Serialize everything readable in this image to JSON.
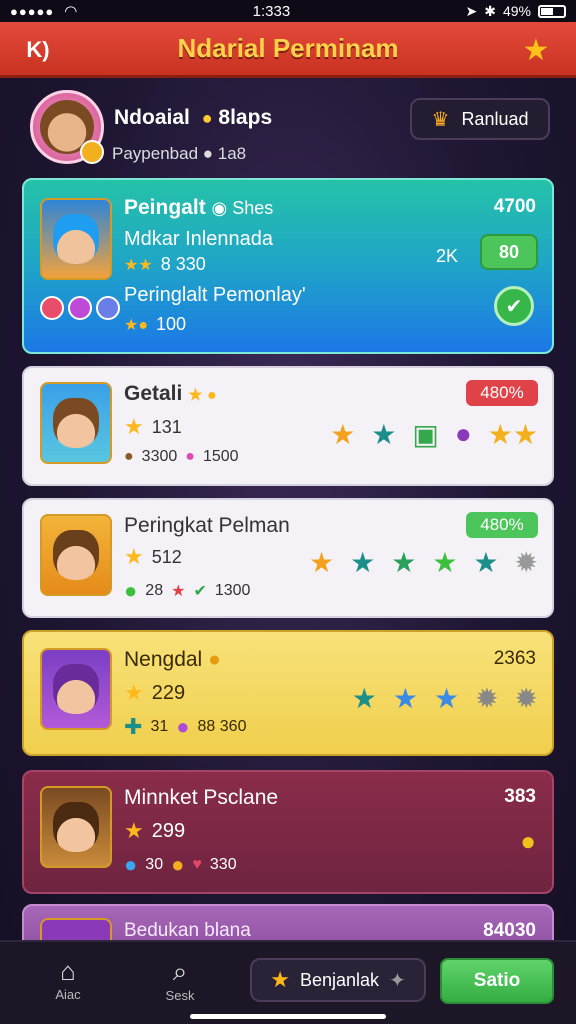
{
  "status": {
    "time": "1:333",
    "battery": "49%"
  },
  "header": {
    "back_label": "K)",
    "title": "Ndarial Perminam"
  },
  "profile": {
    "name": "Ndoaial",
    "name_suffix": "8laps",
    "subtitle": "Paypenbad",
    "subtitle_value": "1a8",
    "button_label": "Ranluad"
  },
  "cards": [
    {
      "title": "Peingalt",
      "title_tag": "Shes",
      "line1": "Mdkar Inlennada",
      "line1_stat": "8 330",
      "line2": "Peringlalt Pemonlay'",
      "line2_stat": "100",
      "top_value": "4700",
      "mid_value": "2K",
      "button_value": "80",
      "color": "#1fa4c8"
    },
    {
      "title": "Getali",
      "stat1": "131",
      "stat2a": "3300",
      "stat2b": "1500",
      "badge": "480%",
      "badge_color": "#e0424a"
    },
    {
      "title": "Peringkat Pelman",
      "stat1": "512",
      "stat2a": "28",
      "stat2b": "1300",
      "badge": "480%",
      "badge_color": "#4cc55a"
    },
    {
      "title": "Nengdal",
      "stat1": "229",
      "stat2a": "31",
      "stat2b": "88 360",
      "right_value": "2363"
    },
    {
      "title": "Minnket Psclane",
      "stat1": "299",
      "stat2a": "30",
      "stat2b": "330",
      "right_value": "383"
    },
    {
      "title": "Bedukan blana",
      "right_value": "84030"
    }
  ],
  "bottom": {
    "home_label": "Aiac",
    "search_label": "Sesk",
    "reward_label": "Benjanlak",
    "action_label": "Satio"
  }
}
